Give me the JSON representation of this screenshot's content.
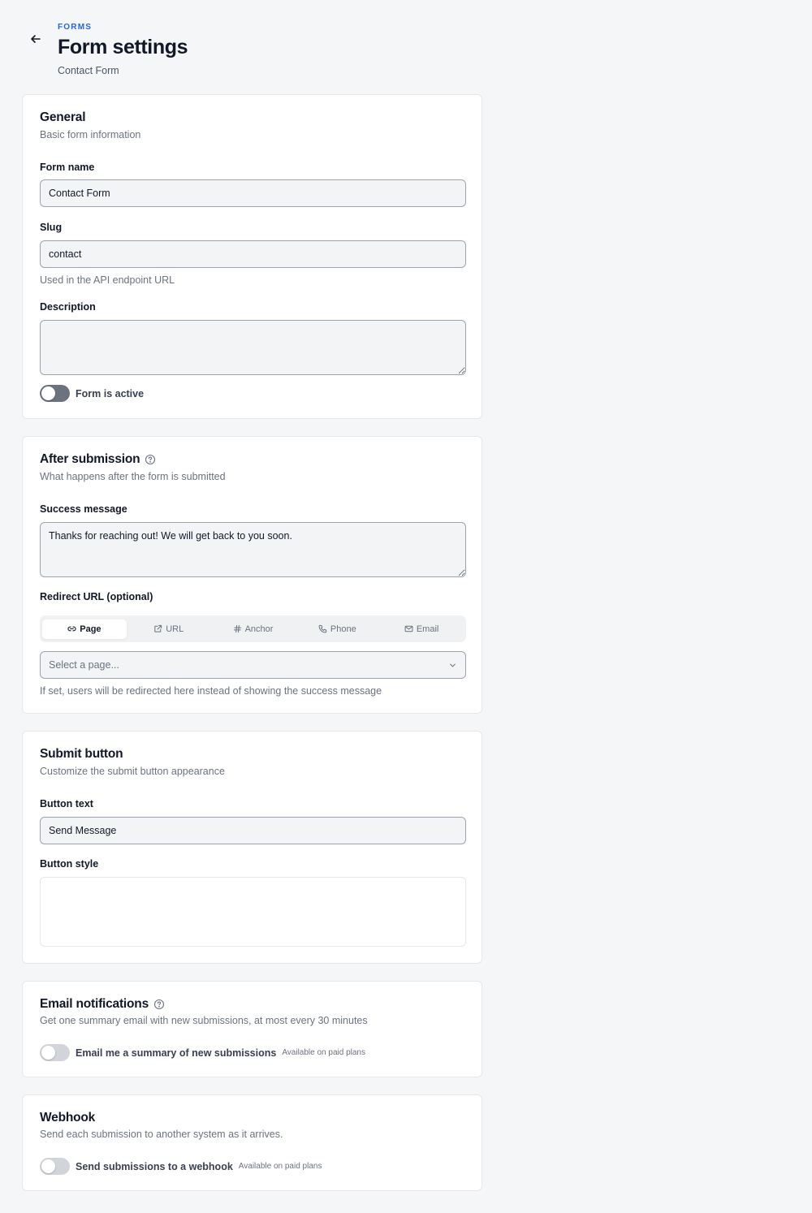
{
  "header": {
    "eyebrow": "FORMS",
    "title": "Form settings",
    "subtitle": "Contact Form",
    "back_icon": "arrow-left-icon"
  },
  "general": {
    "title": "General",
    "description": "Basic form information",
    "form_name_label": "Form name",
    "form_name_value": "Contact Form",
    "slug_label": "Slug",
    "slug_value": "contact",
    "slug_help": "Used in the API endpoint URL",
    "description_label": "Description",
    "description_value": "",
    "active_toggle_label": "Form is active",
    "active_toggle_on": false
  },
  "after_submission": {
    "title": "After submission",
    "description": "What happens after the form is submitted",
    "success_label": "Success message",
    "success_value": "Thanks for reaching out! We will get back to you soon.",
    "redirect_label": "Redirect URL (optional)",
    "redirect_tabs": [
      {
        "label": "Page",
        "icon": "link-icon",
        "active": true
      },
      {
        "label": "URL",
        "icon": "external-link-icon",
        "active": false
      },
      {
        "label": "Anchor",
        "icon": "hash-icon",
        "active": false
      },
      {
        "label": "Phone",
        "icon": "phone-icon",
        "active": false
      },
      {
        "label": "Email",
        "icon": "mail-icon",
        "active": false
      }
    ],
    "select_placeholder": "Select a page...",
    "redirect_help": "If set, users will be redirected here instead of showing the success message"
  },
  "submit_button": {
    "title": "Submit button",
    "description": "Customize the submit button appearance",
    "text_label": "Button text",
    "text_value": "Send Message",
    "style_label": "Button style"
  },
  "email_notifications": {
    "title": "Email notifications",
    "description": "Get one summary email with new submissions, at most every 30 minutes",
    "toggle_label": "Email me a summary of new submissions",
    "badge": "Available on paid plans",
    "toggle_on": false
  },
  "webhook": {
    "title": "Webhook",
    "description": "Send each submission to another system as it arrives.",
    "toggle_label": "Send submissions to a webhook",
    "badge": "Available on paid plans",
    "toggle_on": false
  }
}
